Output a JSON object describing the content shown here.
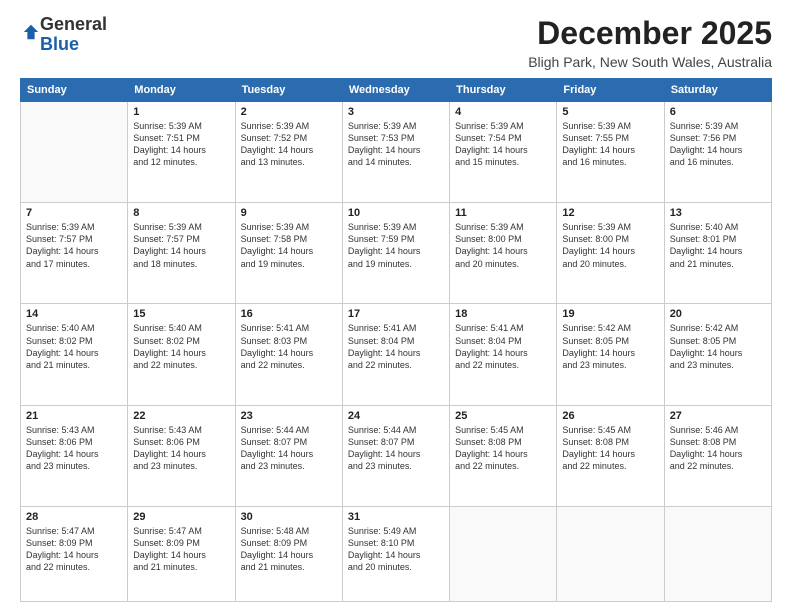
{
  "logo": {
    "general": "General",
    "blue": "Blue"
  },
  "header": {
    "month": "December 2025",
    "location": "Bligh Park, New South Wales, Australia"
  },
  "weekdays": [
    "Sunday",
    "Monday",
    "Tuesday",
    "Wednesday",
    "Thursday",
    "Friday",
    "Saturday"
  ],
  "weeks": [
    [
      {
        "day": "",
        "info": ""
      },
      {
        "day": "1",
        "info": "Sunrise: 5:39 AM\nSunset: 7:51 PM\nDaylight: 14 hours\nand 12 minutes."
      },
      {
        "day": "2",
        "info": "Sunrise: 5:39 AM\nSunset: 7:52 PM\nDaylight: 14 hours\nand 13 minutes."
      },
      {
        "day": "3",
        "info": "Sunrise: 5:39 AM\nSunset: 7:53 PM\nDaylight: 14 hours\nand 14 minutes."
      },
      {
        "day": "4",
        "info": "Sunrise: 5:39 AM\nSunset: 7:54 PM\nDaylight: 14 hours\nand 15 minutes."
      },
      {
        "day": "5",
        "info": "Sunrise: 5:39 AM\nSunset: 7:55 PM\nDaylight: 14 hours\nand 16 minutes."
      },
      {
        "day": "6",
        "info": "Sunrise: 5:39 AM\nSunset: 7:56 PM\nDaylight: 14 hours\nand 16 minutes."
      }
    ],
    [
      {
        "day": "7",
        "info": "Sunrise: 5:39 AM\nSunset: 7:57 PM\nDaylight: 14 hours\nand 17 minutes."
      },
      {
        "day": "8",
        "info": "Sunrise: 5:39 AM\nSunset: 7:57 PM\nDaylight: 14 hours\nand 18 minutes."
      },
      {
        "day": "9",
        "info": "Sunrise: 5:39 AM\nSunset: 7:58 PM\nDaylight: 14 hours\nand 19 minutes."
      },
      {
        "day": "10",
        "info": "Sunrise: 5:39 AM\nSunset: 7:59 PM\nDaylight: 14 hours\nand 19 minutes."
      },
      {
        "day": "11",
        "info": "Sunrise: 5:39 AM\nSunset: 8:00 PM\nDaylight: 14 hours\nand 20 minutes."
      },
      {
        "day": "12",
        "info": "Sunrise: 5:39 AM\nSunset: 8:00 PM\nDaylight: 14 hours\nand 20 minutes."
      },
      {
        "day": "13",
        "info": "Sunrise: 5:40 AM\nSunset: 8:01 PM\nDaylight: 14 hours\nand 21 minutes."
      }
    ],
    [
      {
        "day": "14",
        "info": "Sunrise: 5:40 AM\nSunset: 8:02 PM\nDaylight: 14 hours\nand 21 minutes."
      },
      {
        "day": "15",
        "info": "Sunrise: 5:40 AM\nSunset: 8:02 PM\nDaylight: 14 hours\nand 22 minutes."
      },
      {
        "day": "16",
        "info": "Sunrise: 5:41 AM\nSunset: 8:03 PM\nDaylight: 14 hours\nand 22 minutes."
      },
      {
        "day": "17",
        "info": "Sunrise: 5:41 AM\nSunset: 8:04 PM\nDaylight: 14 hours\nand 22 minutes."
      },
      {
        "day": "18",
        "info": "Sunrise: 5:41 AM\nSunset: 8:04 PM\nDaylight: 14 hours\nand 22 minutes."
      },
      {
        "day": "19",
        "info": "Sunrise: 5:42 AM\nSunset: 8:05 PM\nDaylight: 14 hours\nand 23 minutes."
      },
      {
        "day": "20",
        "info": "Sunrise: 5:42 AM\nSunset: 8:05 PM\nDaylight: 14 hours\nand 23 minutes."
      }
    ],
    [
      {
        "day": "21",
        "info": "Sunrise: 5:43 AM\nSunset: 8:06 PM\nDaylight: 14 hours\nand 23 minutes."
      },
      {
        "day": "22",
        "info": "Sunrise: 5:43 AM\nSunset: 8:06 PM\nDaylight: 14 hours\nand 23 minutes."
      },
      {
        "day": "23",
        "info": "Sunrise: 5:44 AM\nSunset: 8:07 PM\nDaylight: 14 hours\nand 23 minutes."
      },
      {
        "day": "24",
        "info": "Sunrise: 5:44 AM\nSunset: 8:07 PM\nDaylight: 14 hours\nand 23 minutes."
      },
      {
        "day": "25",
        "info": "Sunrise: 5:45 AM\nSunset: 8:08 PM\nDaylight: 14 hours\nand 22 minutes."
      },
      {
        "day": "26",
        "info": "Sunrise: 5:45 AM\nSunset: 8:08 PM\nDaylight: 14 hours\nand 22 minutes."
      },
      {
        "day": "27",
        "info": "Sunrise: 5:46 AM\nSunset: 8:08 PM\nDaylight: 14 hours\nand 22 minutes."
      }
    ],
    [
      {
        "day": "28",
        "info": "Sunrise: 5:47 AM\nSunset: 8:09 PM\nDaylight: 14 hours\nand 22 minutes."
      },
      {
        "day": "29",
        "info": "Sunrise: 5:47 AM\nSunset: 8:09 PM\nDaylight: 14 hours\nand 21 minutes."
      },
      {
        "day": "30",
        "info": "Sunrise: 5:48 AM\nSunset: 8:09 PM\nDaylight: 14 hours\nand 21 minutes."
      },
      {
        "day": "31",
        "info": "Sunrise: 5:49 AM\nSunset: 8:10 PM\nDaylight: 14 hours\nand 20 minutes."
      },
      {
        "day": "",
        "info": ""
      },
      {
        "day": "",
        "info": ""
      },
      {
        "day": "",
        "info": ""
      }
    ]
  ]
}
